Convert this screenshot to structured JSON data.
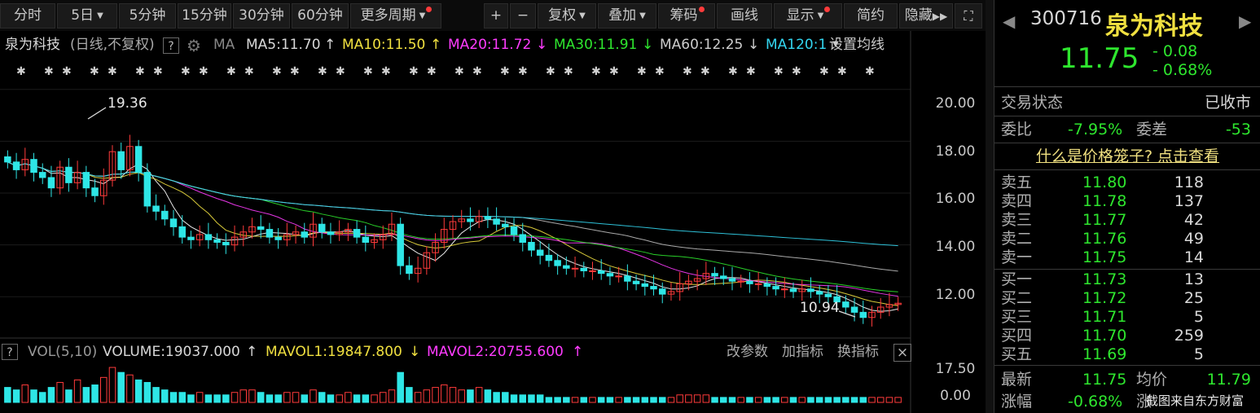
{
  "toolbar": {
    "items": [
      {
        "label": "分时"
      },
      {
        "label": "5日"
      },
      {
        "label": "5分钟"
      },
      {
        "label": "15分钟"
      },
      {
        "label": "30分钟"
      },
      {
        "label": "60分钟"
      },
      {
        "label": "更多周期"
      },
      {
        "label": "+"
      },
      {
        "label": "−"
      },
      {
        "label": "复权"
      },
      {
        "label": "叠加"
      },
      {
        "label": "筹码"
      },
      {
        "label": "画线"
      },
      {
        "label": "显示"
      },
      {
        "label": "简约"
      },
      {
        "label": "隐藏"
      }
    ]
  },
  "ma_bar": {
    "stock_name": "泉为科技",
    "mode": "(日线,不复权)",
    "help": "?",
    "ma_label": "MA",
    "ma5": "MA5:11.70",
    "ma10": "MA10:11.50",
    "ma20": "MA20:11.72",
    "ma30": "MA30:11.91",
    "ma60": "MA60:12.25",
    "ma120": "MA120:1",
    "set_ma": "设置均线"
  },
  "price_axis": {
    "ticks": [
      "20.00",
      "18.00",
      "16.00",
      "14.00",
      "12.00"
    ]
  },
  "annotations": {
    "high": "19.36",
    "low": "10.94"
  },
  "vol_bar": {
    "help": "?",
    "title": "VOL(5,10)",
    "volume": "VOLUME:19037.000",
    "mavol1": "MAVOL1:19847.800",
    "mavol2": "MAVOL2:20755.600",
    "change_params": "改参数",
    "add_indicator": "加指标",
    "switch_indicator": "换指标",
    "close": "×"
  },
  "vol_axis": {
    "ticks": [
      "17.50",
      "0.00"
    ]
  },
  "chart_data": {
    "type": "candlestick",
    "ylim": [
      10.5,
      21
    ],
    "close_series": [
      17.2,
      16.9,
      17.3,
      16.8,
      16.6,
      16.2,
      17.0,
      16.4,
      16.8,
      16.2,
      15.9,
      16.5,
      17.6,
      16.9,
      17.8,
      16.8,
      15.5,
      15.3,
      15.0,
      14.7,
      14.3,
      14.2,
      14.4,
      14.2,
      14.1,
      14.0,
      14.3,
      14.5,
      14.7,
      14.6,
      14.3,
      14.2,
      14.4,
      14.5,
      14.3,
      14.8,
      14.5,
      14.4,
      14.5,
      14.6,
      14.3,
      14.1,
      14.2,
      14.4,
      14.8,
      13.2,
      12.9,
      13.1,
      13.7,
      14.1,
      14.6,
      14.9,
      15.0,
      14.9,
      15.1,
      15.0,
      14.8,
      14.7,
      14.4,
      14.1,
      13.8,
      13.6,
      13.4,
      13.2,
      13.1,
      13.1,
      13.0,
      13.0,
      12.9,
      12.8,
      12.8,
      12.6,
      12.5,
      12.4,
      12.3,
      12.1,
      12.2,
      12.5,
      12.6,
      12.7,
      12.9,
      12.8,
      12.7,
      12.6,
      12.6,
      12.5,
      12.5,
      12.4,
      12.3,
      12.3,
      12.2,
      12.3,
      12.2,
      12.1,
      12.0,
      11.8,
      11.6,
      11.4,
      11.2,
      11.4,
      11.6,
      11.7,
      11.75
    ],
    "volume_series": [
      6,
      5,
      7,
      5,
      4,
      6,
      8,
      5,
      9,
      6,
      7,
      10,
      14,
      12,
      11,
      9,
      8,
      6,
      5,
      4,
      4,
      3,
      4,
      3,
      3,
      3,
      4,
      5,
      5,
      4,
      3,
      3,
      4,
      4,
      3,
      5,
      4,
      3,
      3,
      4,
      3,
      3,
      3,
      4,
      5,
      12,
      6,
      4,
      5,
      6,
      7,
      6,
      5,
      5,
      6,
      5,
      4,
      4,
      3,
      3,
      3,
      3,
      2,
      2,
      2,
      2,
      2,
      2,
      2,
      2,
      2,
      2,
      2,
      2,
      2,
      2,
      2,
      3,
      3,
      3,
      3,
      2,
      2,
      2,
      2,
      2,
      2,
      2,
      2,
      2,
      2,
      2,
      2,
      2,
      2,
      2,
      2,
      2,
      2,
      2,
      2,
      2,
      2
    ]
  },
  "right_panel": {
    "code": "300716",
    "name": "泉为科技",
    "price": "11.75",
    "change": "- 0.08",
    "change_pct": "- 0.68%",
    "status_label": "交易状态",
    "status_value": "已收市",
    "webi_label": "委比",
    "webi_value": "-7.95%",
    "weicha_label": "委差",
    "weicha_value": "-53",
    "cage_link": "什么是价格笼子? 点击查看",
    "asks": [
      {
        "label": "卖五",
        "price": "11.80",
        "vol": "118"
      },
      {
        "label": "卖四",
        "price": "11.78",
        "vol": "137"
      },
      {
        "label": "卖三",
        "price": "11.77",
        "vol": "42"
      },
      {
        "label": "卖二",
        "price": "11.76",
        "vol": "49"
      },
      {
        "label": "卖一",
        "price": "11.75",
        "vol": "14"
      }
    ],
    "bids": [
      {
        "label": "买一",
        "price": "11.73",
        "vol": "13"
      },
      {
        "label": "买二",
        "price": "11.72",
        "vol": "25"
      },
      {
        "label": "买三",
        "price": "11.71",
        "vol": "5"
      },
      {
        "label": "买四",
        "price": "11.70",
        "vol": "259"
      },
      {
        "label": "买五",
        "price": "11.69",
        "vol": "5"
      }
    ],
    "latest_label": "最新",
    "latest_value": "11.75",
    "avg_label": "均价",
    "avg_value": "11.79",
    "zf_label": "涨幅",
    "zf_value": "-0.68%",
    "zf2_label": "涨"
  },
  "watermark": "截图来自东方财富",
  "colors": {
    "up": "#ff3b3b",
    "down": "#2ee6e6",
    "ma5": "#ffffff",
    "ma10": "#f0e040",
    "ma20": "#ff3cff",
    "ma30": "#2ee62e",
    "ma60": "#bbbbbb",
    "ma120": "#33d6f0"
  }
}
